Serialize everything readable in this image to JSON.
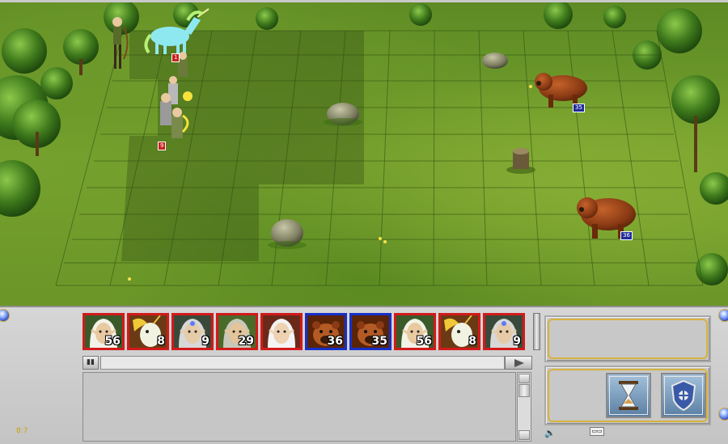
{
  "battlefield": {
    "badges": [
      {
        "id": "unicorn-stack",
        "label": "1",
        "side": "red"
      },
      {
        "id": "elves-stack",
        "label": "9",
        "side": "red"
      },
      {
        "id": "bear-top",
        "label": "35",
        "side": "blue"
      },
      {
        "id": "bear-bottom",
        "label": "36",
        "side": "blue"
      }
    ]
  },
  "turn_queue": [
    {
      "side": "red",
      "unit": "elf-hero",
      "count": "56"
    },
    {
      "side": "red",
      "unit": "unicorn",
      "count": "8"
    },
    {
      "side": "red",
      "unit": "elf-sorceress",
      "count": "9"
    },
    {
      "side": "red",
      "unit": "elf-archer",
      "count": "29"
    },
    {
      "side": "red",
      "unit": "elf-lord",
      "count": ""
    },
    {
      "side": "blue",
      "unit": "bear",
      "count": "36"
    },
    {
      "side": "blue",
      "unit": "bear",
      "count": "35"
    },
    {
      "side": "red",
      "unit": "elf-hero",
      "count": "56"
    },
    {
      "side": "red",
      "unit": "unicorn",
      "count": "8"
    },
    {
      "side": "red",
      "unit": "elf-sorceress",
      "count": "9"
    }
  ],
  "chat": {
    "input_value": "",
    "channel_button": "▮▮"
  },
  "actions": {
    "wait_icon": "hourglass-icon",
    "defend_icon": "shield-icon"
  },
  "status": {
    "coords": "8:7",
    "small_button": "▭▭"
  }
}
